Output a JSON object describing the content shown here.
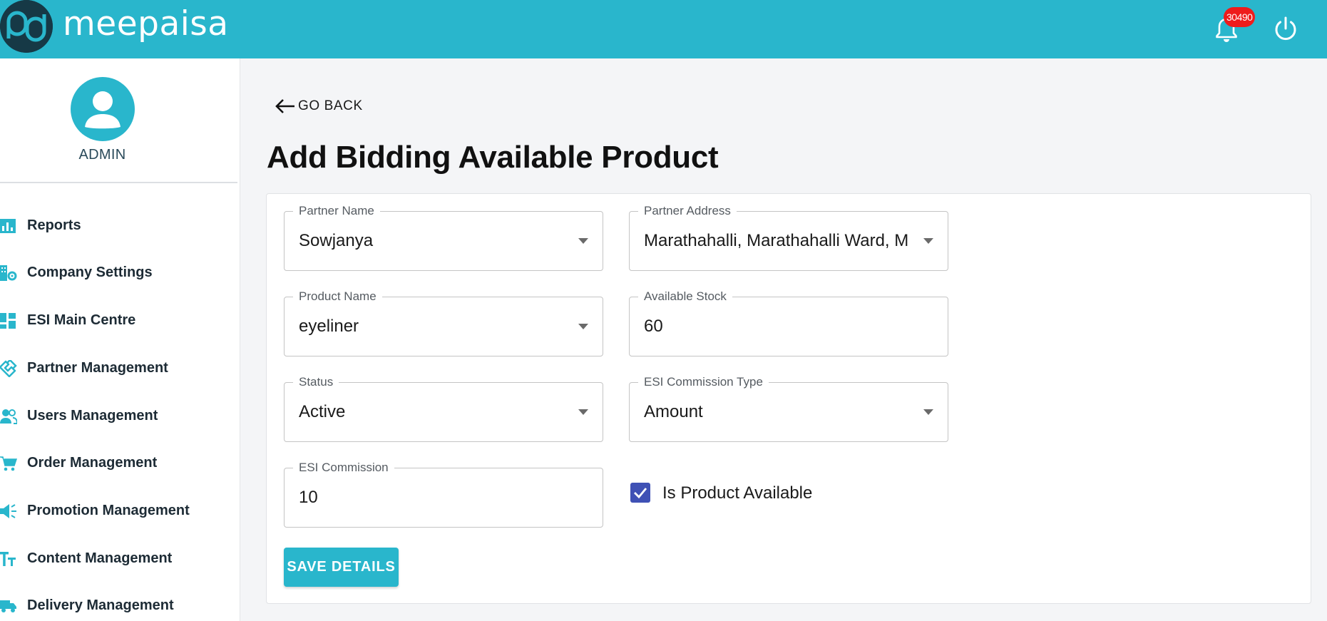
{
  "header": {
    "brand": "meepaisa",
    "notification_count": "30490",
    "colors": {
      "bar": "#29b6cc",
      "badge": "#ee1c1c"
    },
    "icons": [
      "meepaisa-logo",
      "bell-icon",
      "power-icon"
    ]
  },
  "sidebar": {
    "user_label": "ADMIN",
    "items": [
      {
        "label": "Reports",
        "icon": "bar-chart-icon"
      },
      {
        "label": "Company Settings",
        "icon": "company-settings-icon"
      },
      {
        "label": "ESI Main Centre",
        "icon": "dashboard-icon"
      },
      {
        "label": "Partner Management",
        "icon": "handshake-icon"
      },
      {
        "label": "Users Management",
        "icon": "users-icon"
      },
      {
        "label": "Order Management",
        "icon": "cart-icon"
      },
      {
        "label": "Promotion Management",
        "icon": "megaphone-icon"
      },
      {
        "label": "Content Management",
        "icon": "text-size-icon"
      },
      {
        "label": "Delivery Management",
        "icon": "truck-icon"
      }
    ]
  },
  "main": {
    "go_back": "GO BACK",
    "title": "Add Bidding Available Product",
    "form": {
      "partner_name": {
        "label": "Partner Name",
        "value": "Sowjanya"
      },
      "partner_address": {
        "label": "Partner Address",
        "value": "Marathahalli, Marathahalli Ward, Marathahalli"
      },
      "product_name": {
        "label": "Product Name",
        "value": "eyeliner"
      },
      "available_stock": {
        "label": "Available Stock",
        "value": "60"
      },
      "status": {
        "label": "Status",
        "value": "Active"
      },
      "esi_commission_type": {
        "label": "ESI Commission Type",
        "value": "Amount"
      },
      "esi_commission": {
        "label": "ESI Commission",
        "value": "10"
      },
      "is_product_available": {
        "label": "Is Product Available",
        "checked": true
      },
      "save_label": "SAVE DETAILS"
    }
  }
}
